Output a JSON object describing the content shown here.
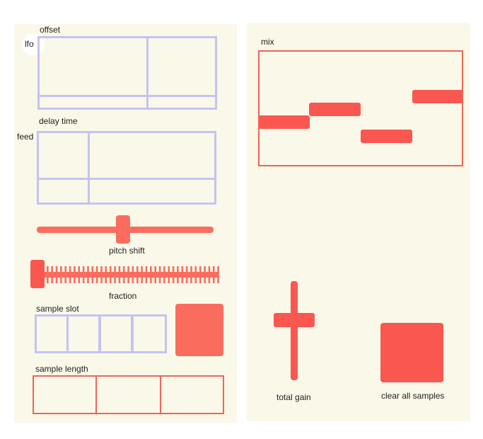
{
  "colors": {
    "panel_bg": "#faf8e8",
    "lavender": "#c6c3f2",
    "accent_red": "#fa5750",
    "salmon": "#fa6d5e"
  },
  "left_panel": {
    "lfo_label": "lfo",
    "offset_label": "offset",
    "delay_time_label": "delay time",
    "feed_label": "feed",
    "pitch_shift_label": "pitch shift",
    "fraction_label": "fraction",
    "sample_slot_label": "sample slot",
    "sample_length_label": "sample length",
    "pitch_shift_value": 0.48,
    "fraction_value": 0.0,
    "sample_slot_count": 4,
    "sample_length_segments": 3
  },
  "right_panel": {
    "mix_label": "mix",
    "total_gain_label": "total gain",
    "clear_all_label": "clear all samples",
    "mix_levels": [
      0.35,
      0.55,
      0.25,
      0.6
    ],
    "total_gain_value": 0.6
  }
}
